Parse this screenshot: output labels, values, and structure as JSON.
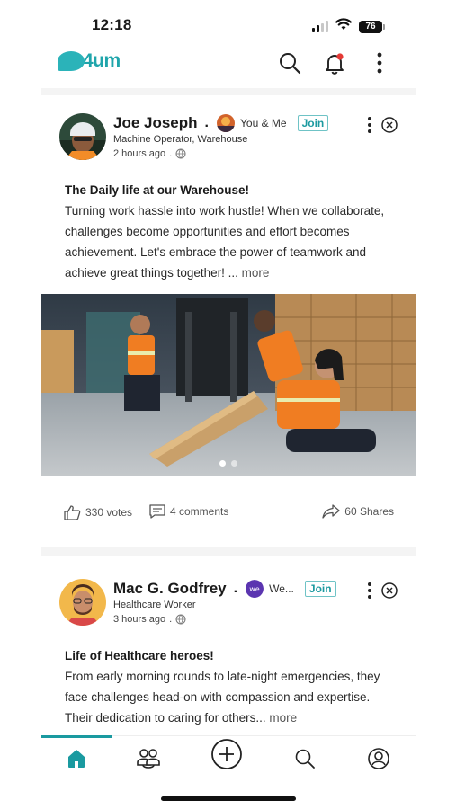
{
  "status_bar": {
    "time": "12:18",
    "battery": "76"
  },
  "header": {
    "logo_text": "4um",
    "brand_color": "#1fa5ab"
  },
  "posts": [
    {
      "author": "Joe Joseph",
      "group": "You & Me",
      "join_label": "Join",
      "role": "Machine Operator, Warehouse",
      "time": "2 hours ago",
      "title": "The Daily life at our Warehouse!",
      "body": "Turning work hassle into work hustle! When we collaborate, challenges become opportunities and effort becomes achievement. Let's embrace the power of teamwork and achieve great things together! ...",
      "more_label": "more",
      "votes": "330 votes",
      "comments": "4 comments",
      "shares": "60 Shares",
      "carousel": {
        "count": 2,
        "active": 1
      }
    },
    {
      "author": "Mac G. Godfrey",
      "group": "We...",
      "join_label": "Join",
      "role": "Healthcare Worker",
      "time": "3 hours ago",
      "title": "Life of Healthcare heroes!",
      "body": "From early morning rounds to late-night emergencies, they face challenges head-on with compassion and expertise. Their dedication to caring for others...",
      "more_label": "more"
    }
  ],
  "nav": {
    "items": [
      {
        "icon": "home-icon",
        "active": true
      },
      {
        "icon": "community-icon",
        "active": false
      },
      {
        "icon": "create-post-icon",
        "active": false
      },
      {
        "icon": "search-icon",
        "active": false
      },
      {
        "icon": "profile-icon",
        "active": false
      }
    ],
    "accent": "#1a9aa0"
  }
}
